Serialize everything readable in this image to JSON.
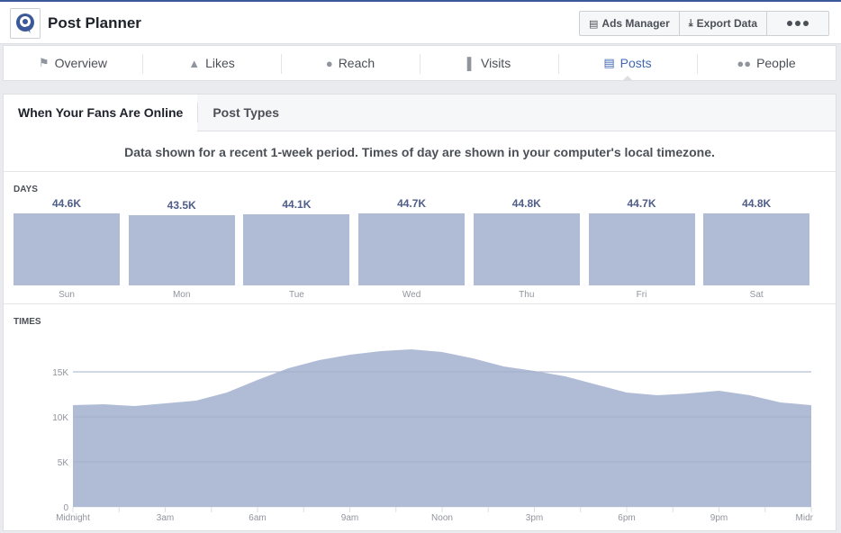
{
  "header": {
    "title": "Post Planner",
    "buttons": {
      "ads_manager": "Ads Manager",
      "export_data": "Export Data"
    }
  },
  "nav": {
    "items": [
      {
        "label": "Overview",
        "icon": "megaphone-icon"
      },
      {
        "label": "Likes",
        "icon": "thumbs-up-icon"
      },
      {
        "label": "Reach",
        "icon": "people-icon"
      },
      {
        "label": "Visits",
        "icon": "bar-chart-icon"
      },
      {
        "label": "Posts",
        "icon": "posts-icon"
      },
      {
        "label": "People",
        "icon": "group-icon"
      }
    ],
    "active": "Posts"
  },
  "subtabs": {
    "fans_online": "When Your Fans Are Online",
    "post_types": "Post Types"
  },
  "notice": "Data shown for a recent 1-week period. Times of day are shown in your computer's local timezone.",
  "days_section": {
    "label": "DAYS"
  },
  "times_section": {
    "label": "TIMES"
  },
  "colors": {
    "bar": "#b0bcd6",
    "accent": "#4267b2",
    "value_text": "#4e5d8a"
  },
  "chart_data": [
    {
      "type": "bar",
      "title": "DAYS",
      "categories": [
        "Sun",
        "Mon",
        "Tue",
        "Wed",
        "Thu",
        "Fri",
        "Sat"
      ],
      "labels": [
        "44.6K",
        "43.5K",
        "44.1K",
        "44.7K",
        "44.8K",
        "44.7K",
        "44.8K"
      ],
      "values": [
        44600,
        43500,
        44100,
        44700,
        44800,
        44700,
        44800
      ]
    },
    {
      "type": "area",
      "title": "TIMES",
      "x_tick_labels": [
        "Midnight",
        "3am",
        "6am",
        "9am",
        "Noon",
        "3pm",
        "6pm",
        "9pm",
        "Midr"
      ],
      "y_tick_labels": [
        "0",
        "5K",
        "10K",
        "15K"
      ],
      "ylim": [
        0,
        20000
      ],
      "grid": true,
      "x_hours": [
        0,
        1,
        2,
        3,
        4,
        5,
        6,
        7,
        8,
        9,
        10,
        11,
        12,
        13,
        14,
        15,
        16,
        17,
        18,
        19,
        20,
        21,
        22,
        23
      ],
      "values": [
        11300,
        11400,
        11200,
        11500,
        11800,
        12700,
        14100,
        15400,
        16300,
        16900,
        17300,
        17500,
        17200,
        16500,
        15600,
        15100,
        14500,
        13600,
        12700,
        12400,
        12600,
        12900,
        12400,
        11600,
        11300
      ]
    }
  ]
}
